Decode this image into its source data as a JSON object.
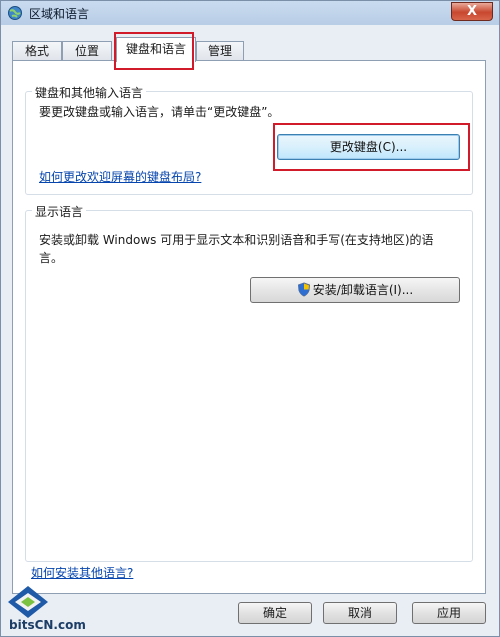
{
  "window": {
    "title": "区域和语言",
    "close_label": "X"
  },
  "tabs": [
    {
      "label": "格式"
    },
    {
      "label": "位置"
    },
    {
      "label": "键盘和语言"
    },
    {
      "label": "管理"
    }
  ],
  "keyboard_group": {
    "title": "键盘和其他输入语言",
    "description": "要更改键盘或输入语言，请单击“更改键盘”。",
    "change_button": "更改键盘(C)...",
    "link": "如何更改欢迎屏幕的键盘布局?"
  },
  "display_group": {
    "title": "显示语言",
    "description_line1": "安装或卸载 Windows 可用于显示文本和识别语音和手写(在支持地区)的语",
    "description_line2": "言。",
    "install_button": "安装/卸载语言(I)..."
  },
  "bottom_link": "如何安装其他语言?",
  "footer": {
    "ok": "确定",
    "cancel": "取消",
    "apply": "应用"
  },
  "watermark": {
    "text": "bitsCN.com"
  },
  "colors": {
    "highlight": "#d11a2a",
    "link": "#0645ad"
  }
}
